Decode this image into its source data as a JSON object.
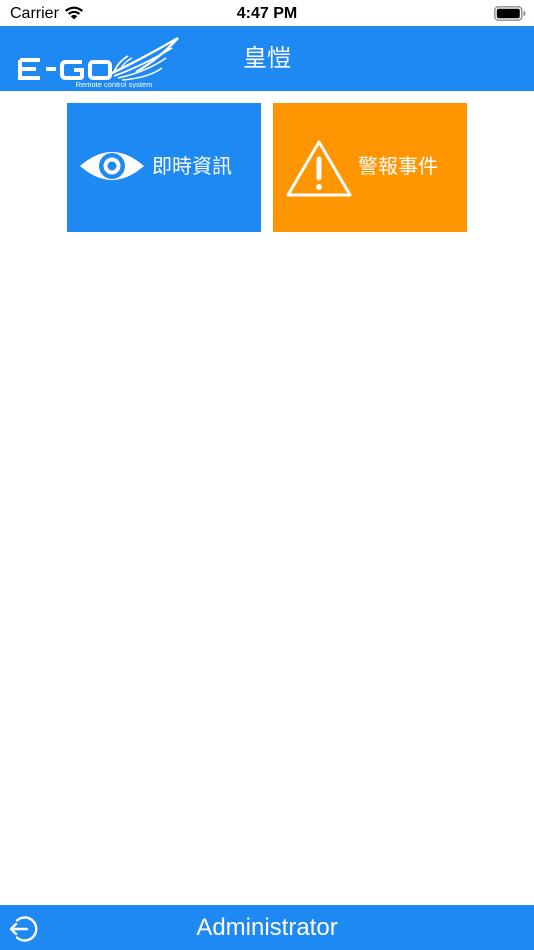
{
  "status_bar": {
    "carrier": "Carrier",
    "time": "4:47 PM",
    "wifi_icon": "wifi-icon",
    "battery_icon": "battery-icon"
  },
  "nav_bar": {
    "logo_text": "E-GO",
    "logo_tagline": "Remote control system",
    "title": "皇愷",
    "background": "#1e88f3"
  },
  "tiles": [
    {
      "label": "即時資訊",
      "icon": "eye-icon",
      "color": "#1e88f3"
    },
    {
      "label": "警報事件",
      "icon": "warning-icon",
      "color": "#ff9500"
    }
  ],
  "bottom_bar": {
    "icon": "logout-icon",
    "label": "Administrator",
    "background": "#1e88f3"
  }
}
